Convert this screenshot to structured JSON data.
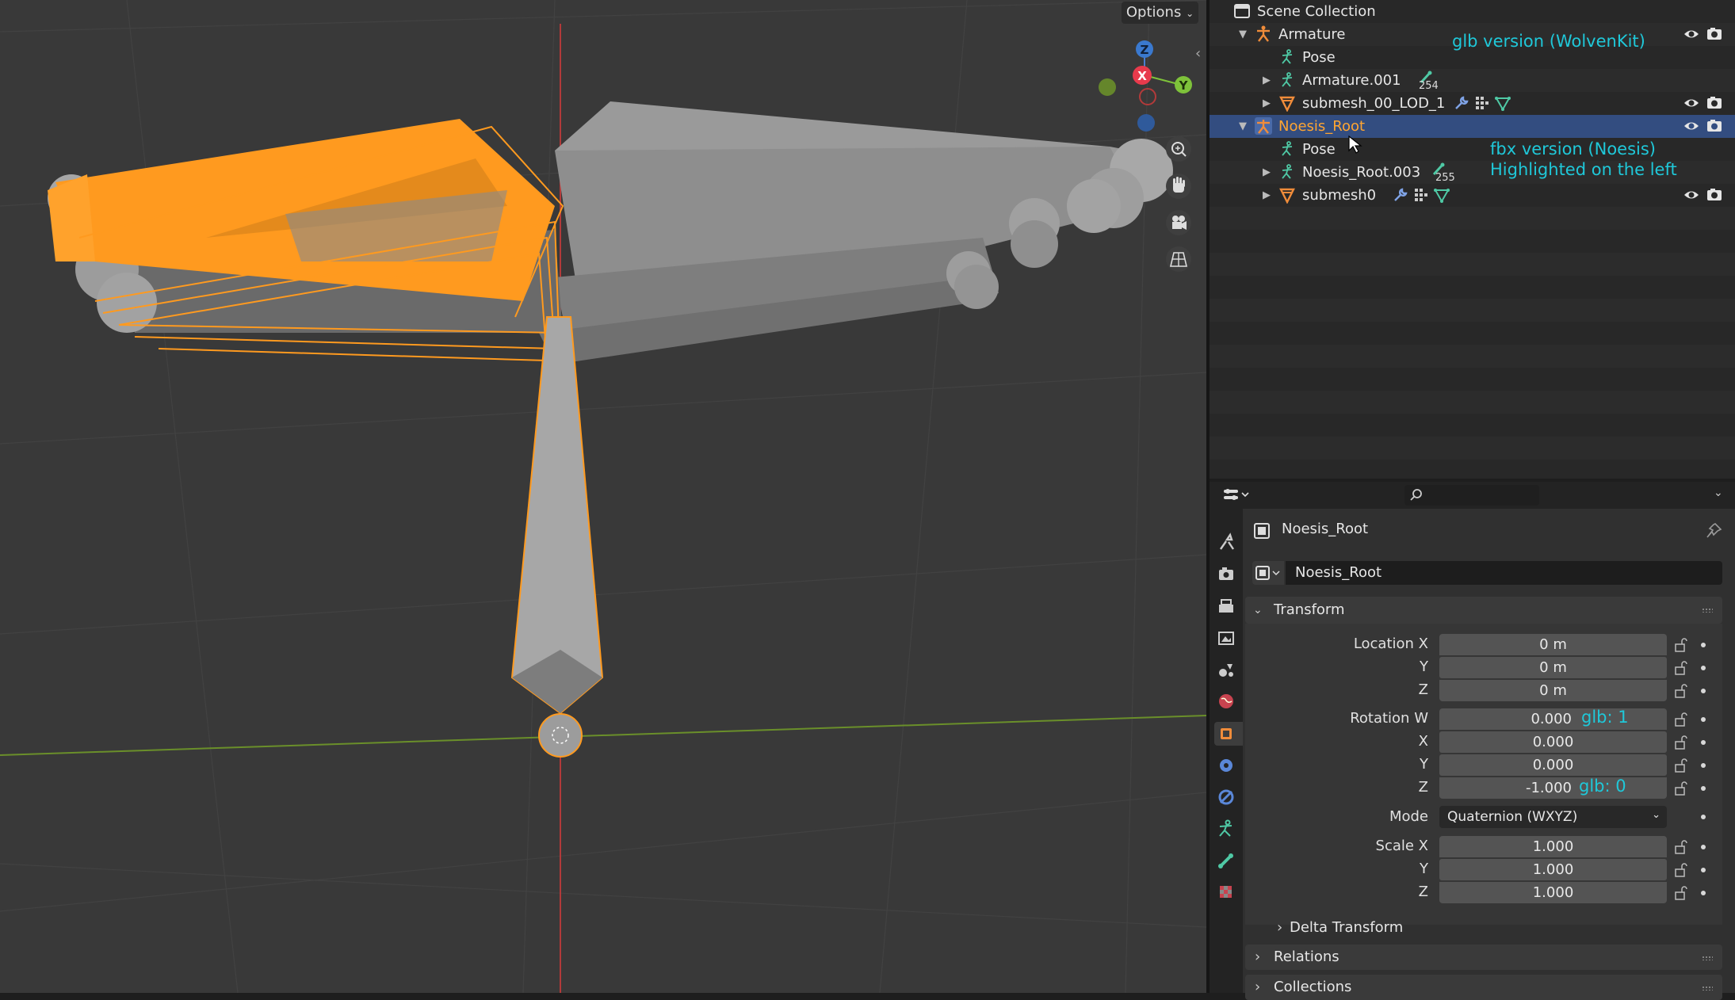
{
  "viewport": {
    "options_label": "Options",
    "gizmo_axes": {
      "z": "Z",
      "x": "X",
      "y": "Y"
    },
    "icons": [
      "zoom-icon",
      "pan-hand-icon",
      "camera-icon",
      "grid-perspective-icon"
    ],
    "colors": {
      "selection": "#ff9a1f",
      "x_axis_line": "#b23a3a",
      "y_axis_line": "#6a8f2a",
      "background": "#393939"
    }
  },
  "outliner": {
    "rows": [
      {
        "label": "Scene Collection"
      },
      {
        "label": "Armature"
      },
      {
        "label": "Pose"
      },
      {
        "label": "Armature.001",
        "count": "254"
      },
      {
        "label": "submesh_00_LOD_1"
      },
      {
        "label": "Noesis_Root",
        "selected": true
      },
      {
        "label": "Pose"
      },
      {
        "label": "Noesis_Root.003",
        "count": "255"
      },
      {
        "label": "submesh0"
      }
    ],
    "annotations": {
      "glb": "glb version (WolvenKit)",
      "fbx_line1": "fbx version (Noesis)",
      "fbx_line2": "Highlighted on the left"
    },
    "annotation_color": "#1fc8d9",
    "selected_color": "#334d80",
    "selected_text_color": "#ffa531"
  },
  "properties": {
    "search_placeholder": "",
    "object_name": "Noesis_Root",
    "datablock_name": "Noesis_Root",
    "transform": {
      "title": "Transform",
      "location": {
        "label_x": "Location X",
        "label_y": "Y",
        "label_z": "Z",
        "x": "0 m",
        "y": "0 m",
        "z": "0 m"
      },
      "rotation": {
        "label_w": "Rotation W",
        "label_x": "X",
        "label_y": "Y",
        "label_z": "Z",
        "w": "0.000",
        "x": "0.000",
        "y": "0.000",
        "z": "-1.000",
        "note_w": "glb: 1",
        "note_z": "glb: 0"
      },
      "mode_label": "Mode",
      "mode_value": "Quaternion (WXYZ)",
      "scale": {
        "label_x": "Scale X",
        "label_y": "Y",
        "label_z": "Z",
        "x": "1.000",
        "y": "1.000",
        "z": "1.000"
      },
      "delta": "Delta Transform"
    },
    "relations": "Relations",
    "collections": "Collections",
    "tabs": [
      "tool-icon",
      "render-icon",
      "output-icon",
      "view-layer-icon",
      "scene-icon",
      "world-icon",
      "object-icon",
      "physics-icon",
      "constraints-icon",
      "object-data-armature-icon",
      "bone-icon",
      "texture-icon"
    ]
  }
}
